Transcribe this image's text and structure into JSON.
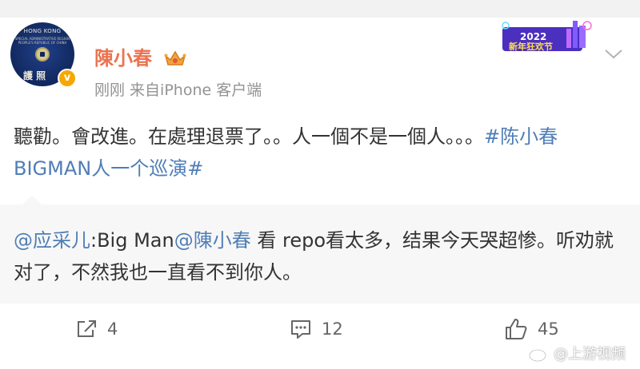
{
  "user": {
    "name": "陳小春",
    "meta": "刚刚 来自iPhone 客户端",
    "avatar_text_top": "HONG KONG",
    "avatar_text_line": "SPECIAL ADMINISTRATIVE REGION PEOPLE'S REPUBLIC OF CHINA",
    "avatar_text_bottom": "護  照"
  },
  "banner": {
    "year": "2022",
    "text": "新年狂欢节"
  },
  "post": {
    "text": "聽勸。會改進。在處理退票了。。人一個不是一個人。。。",
    "hashtag": "#陈小春BIGMAN人一个巡演#"
  },
  "quote": {
    "author": "@应采儿",
    "mid1": ":Big Man",
    "mention": "@陳小春",
    "rest": " 看 repo看太多，结果今天哭超惨。听劝就对了，不然我也一直看不到你人。"
  },
  "actions": {
    "repost": "4",
    "comment": "12",
    "like": "45"
  },
  "watermark": "@上游视频",
  "colors": {
    "accent": "#eb7350",
    "link": "#4f7eb6",
    "verified": "#f6a800"
  }
}
